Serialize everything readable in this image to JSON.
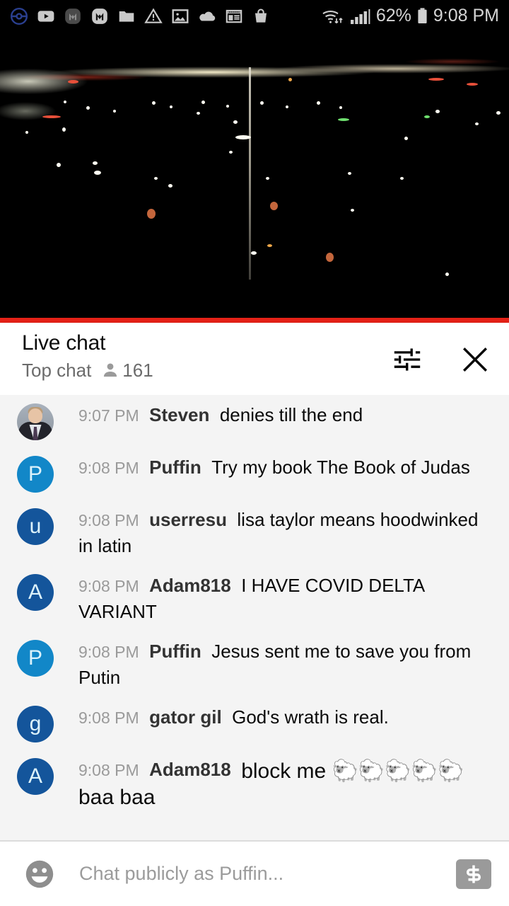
{
  "status_bar": {
    "icons": [
      {
        "name": "pokemon-go-icon",
        "glyph": "pokeball"
      },
      {
        "name": "youtube-icon",
        "glyph": "youtube"
      },
      {
        "name": "messenger-dark-icon",
        "glyph": "m-dark"
      },
      {
        "name": "messenger-icon",
        "glyph": "m-light"
      },
      {
        "name": "folder-icon",
        "glyph": "folder"
      },
      {
        "name": "warning-icon",
        "glyph": "warning"
      },
      {
        "name": "photos-icon",
        "glyph": "image"
      },
      {
        "name": "cloud-icon",
        "glyph": "cloud"
      },
      {
        "name": "news-icon",
        "glyph": "news"
      },
      {
        "name": "shopping-bag-icon",
        "glyph": "bag"
      }
    ],
    "wifi_icon": "wifi-transfer-icon",
    "signal_icon": "cellular-signal-icon",
    "battery_percent": "62%",
    "battery_icon": "battery-icon",
    "clock": "9:08 PM"
  },
  "player": {
    "name": "live-video-player",
    "scene_description": "night cityscape with distant lights",
    "progress_bar_color": "#e52117",
    "progress_percent": 100
  },
  "chat_header": {
    "title": "Live chat",
    "mode": "Top chat",
    "viewer_icon": "person-icon",
    "viewer_count": "161",
    "tune_icon": "tune-icon",
    "close_icon": "close-icon"
  },
  "messages": [
    {
      "timestamp": "9:07 PM",
      "author": "Steven",
      "text": "denies till the end",
      "avatar_type": "photo",
      "avatar_letter": "",
      "avatar_color": "#9aa2ac"
    },
    {
      "timestamp": "9:08 PM",
      "author": "Puffin",
      "text": "Try my book The Book of Judas",
      "avatar_type": "letter",
      "avatar_letter": "P",
      "avatar_color": "#1287c8"
    },
    {
      "timestamp": "9:08 PM",
      "author": "userresu",
      "text": "lisa taylor means hoodwinked in latin",
      "avatar_type": "letter",
      "avatar_letter": "u",
      "avatar_color": "#14559b"
    },
    {
      "timestamp": "9:08 PM",
      "author": "Adam818",
      "text": "I HAVE COVID DELTA VARIANT",
      "avatar_type": "letter",
      "avatar_letter": "A",
      "avatar_color": "#14559b"
    },
    {
      "timestamp": "9:08 PM",
      "author": "Puffin",
      "text": "Jesus sent me to save you from Putin",
      "avatar_type": "letter",
      "avatar_letter": "P",
      "avatar_color": "#1287c8"
    },
    {
      "timestamp": "9:08 PM",
      "author": "gator gil",
      "text": "God's wrath is real.",
      "avatar_type": "letter",
      "avatar_letter": "g",
      "avatar_color": "#14559b"
    },
    {
      "timestamp": "9:08 PM",
      "author": "Adam818",
      "text": "block me 🐑🐑🐑🐑🐑baa baa",
      "avatar_type": "letter",
      "avatar_letter": "A",
      "avatar_color": "#14559b"
    }
  ],
  "input_bar": {
    "emoji_icon": "emoji-smiley-icon",
    "placeholder": "Chat publicly as Puffin...",
    "value": "",
    "superchat_icon": "dollar-superchat-icon"
  }
}
